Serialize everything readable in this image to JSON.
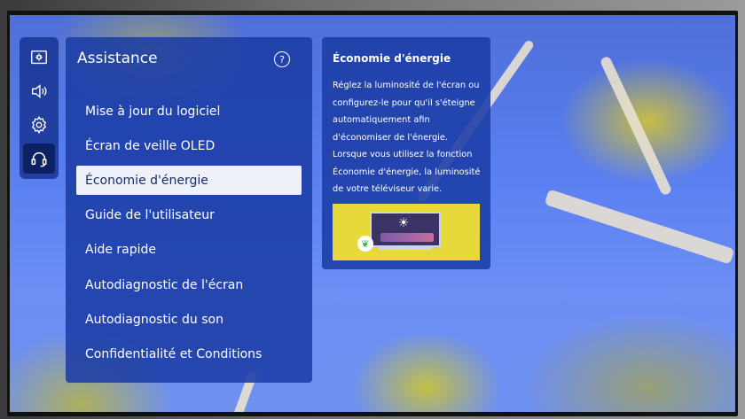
{
  "panel": {
    "title": "Assistance",
    "help_icon": "?"
  },
  "rail": {
    "items": [
      {
        "icon": "picture-settings-icon"
      },
      {
        "icon": "sound-icon"
      },
      {
        "icon": "gear-icon"
      },
      {
        "icon": "headset-icon",
        "active": true
      }
    ]
  },
  "menu": {
    "items": [
      {
        "label": "Mise à jour du logiciel"
      },
      {
        "label": "Écran de veille OLED"
      },
      {
        "label": "Économie d'énergie",
        "selected": true
      },
      {
        "label": "Guide de l'utilisateur"
      },
      {
        "label": "Aide rapide"
      },
      {
        "label": "Autodiagnostic de l'écran"
      },
      {
        "label": "Autodiagnostic du son"
      },
      {
        "label": "Confidentialité et Conditions"
      }
    ]
  },
  "info": {
    "title": "Économie d'énergie",
    "description": "Réglez la luminosité de l'écran ou configurez-le pour qu'il s'éteigne automatiquement afin d'économiser de l'énergie. Lorsque vous utilisez la fonction Économie d'énergie, la luminosité de votre téléviseur varie.",
    "illustration_icon": "energy-saving-illustration"
  },
  "colors": {
    "panel_bg": "#1b3ca5",
    "selected_bg": "#eef1f8",
    "text": "#ffffff"
  }
}
